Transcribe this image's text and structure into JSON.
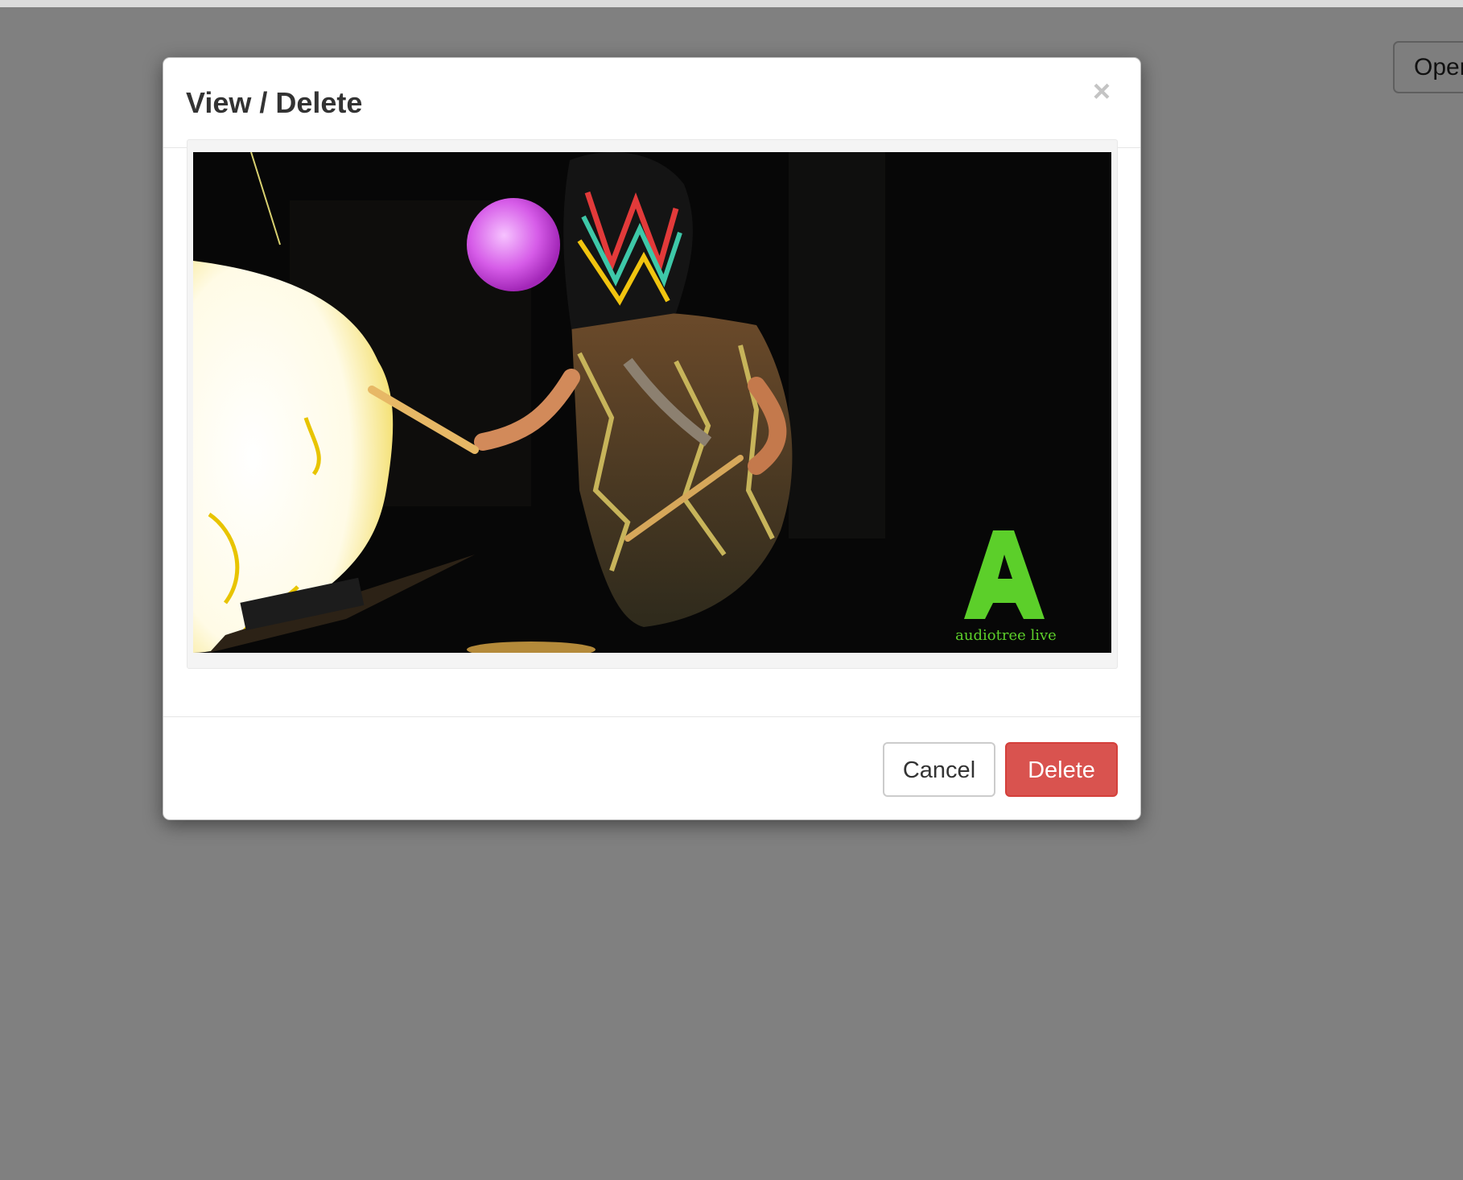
{
  "background": {
    "button_label": "Oper"
  },
  "modal": {
    "title": "View / Delete",
    "close_glyph": "×",
    "image": {
      "alt": "audiotree live"
    },
    "footer": {
      "cancel_label": "Cancel",
      "delete_label": "Delete"
    }
  },
  "colors": {
    "backdrop": "#808080",
    "delete_button": "#d9534f",
    "logo_green": "#5ccf2a"
  }
}
